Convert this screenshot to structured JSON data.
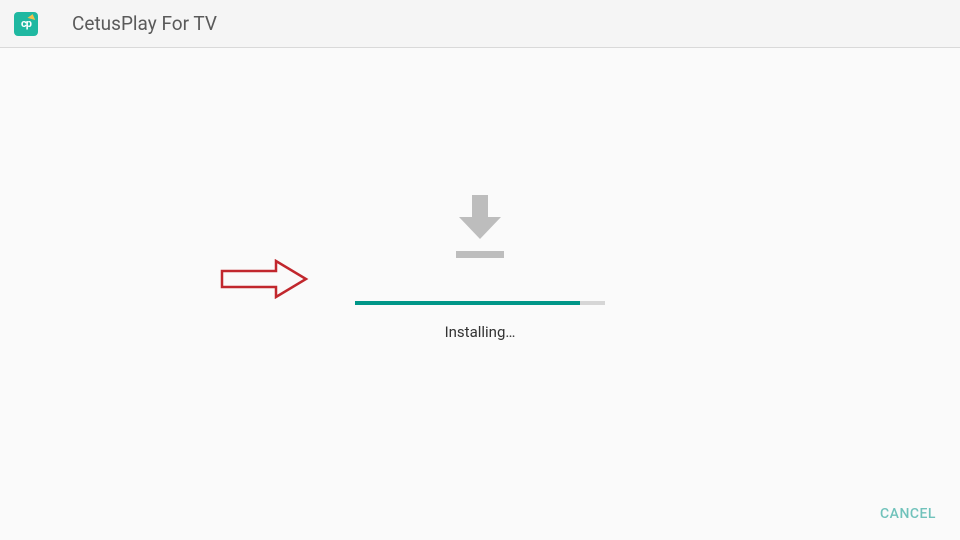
{
  "header": {
    "app_icon_text": "cp",
    "app_title": "CetusPlay For TV"
  },
  "install": {
    "status_text": "Installing…",
    "progress_percent": 90
  },
  "footer": {
    "cancel_label": "CANCEL"
  },
  "colors": {
    "accent": "#009688",
    "icon_bg": "#1fb8a1"
  }
}
